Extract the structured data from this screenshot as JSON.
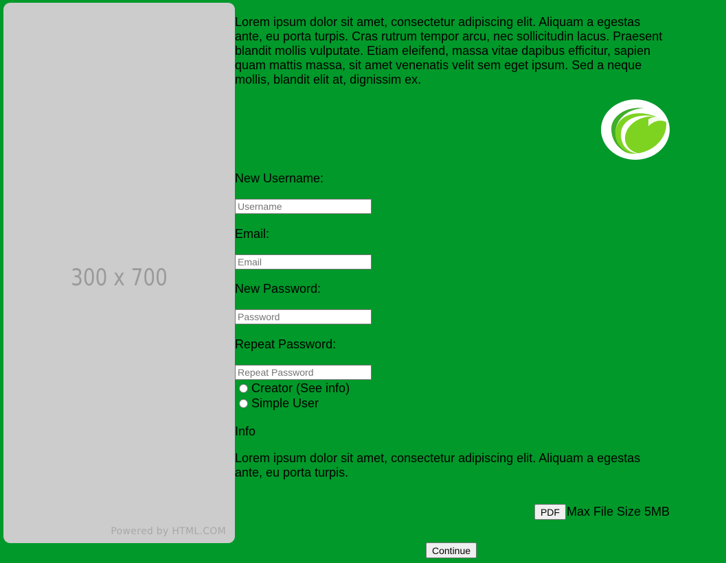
{
  "sidebar_image": {
    "dimensions_text": "300 x 700",
    "powered_text": "Powered by HTML.COM"
  },
  "intro_text": "Lorem ipsum dolor sit amet, consectetur adipiscing elit. Aliquam a egestas ante, eu porta turpis. Cras rutrum tempor arcu, nec sollicitudin lacus. Praesent blandit mollis vulputate. Etiam eleifend, massa vitae dapibus efficitur, sapien quam mattis massa, sit amet venenatis velit sem eget ipsum. Sed a neque mollis, blandit elit at, dignissim ex.",
  "logo": {
    "icon": "leaf-logo-icon",
    "colors": [
      "#ffffff",
      "#7ed321",
      "#3fae2a"
    ]
  },
  "form": {
    "username": {
      "label": "New Username:",
      "placeholder": "Username",
      "value": ""
    },
    "email": {
      "label": "Email:",
      "placeholder": "Email",
      "value": ""
    },
    "password": {
      "label": "New Password:",
      "placeholder": "Password",
      "value": ""
    },
    "repeat_password": {
      "label": "Repeat Password:",
      "placeholder": "Repeat Password",
      "value": ""
    },
    "roles": [
      {
        "label": "Creator (See info)",
        "checked": false
      },
      {
        "label": "Simple User",
        "checked": false
      }
    ]
  },
  "info": {
    "title": "Info",
    "text": "Lorem ipsum dolor sit amet, consectetur adipiscing elit. Aliquam a egestas ante, eu porta turpis."
  },
  "upload": {
    "button_label": "PDF",
    "note": "Max File Size 5MB"
  },
  "continue_label": "Continue",
  "colors": {
    "background": "#00992a",
    "placeholder_bg": "#cccccc"
  }
}
